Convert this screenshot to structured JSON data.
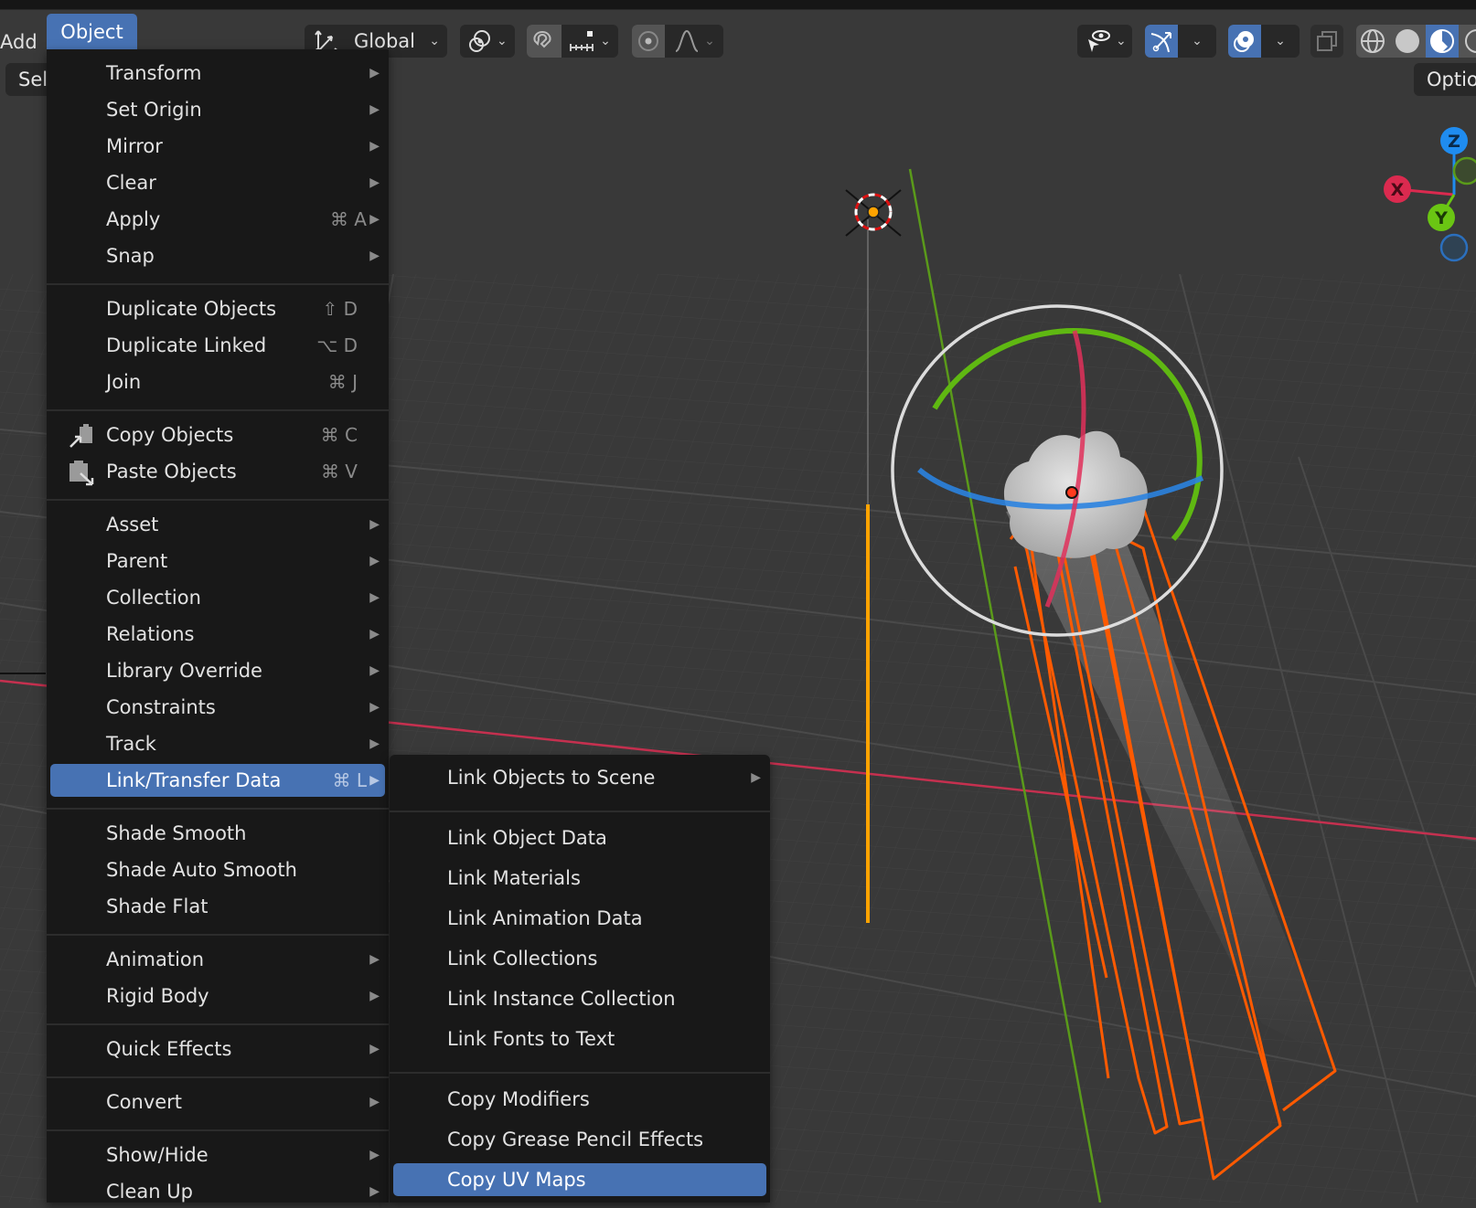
{
  "header": {
    "add_menu": "Add",
    "object_menu": "Object",
    "select_button": "Sel",
    "orientation": {
      "value": "Global",
      "icon": "transform-orientation-icon"
    },
    "pivot": {
      "icon": "pivot-point-icon"
    },
    "snap": {
      "icon": "magnet-snap-icon",
      "increment_icon": "snap-increment-icon"
    },
    "proportional": {
      "icon": "proportional-editing-icon",
      "falloff_icon": "falloff-curve-icon"
    },
    "visibility": {
      "icon": "eye-select-icon"
    },
    "gizmo": {
      "icon": "gizmo-icon",
      "active": true
    },
    "overlays": {
      "icon": "overlays-icon",
      "active": true
    },
    "xray": {
      "icon": "xray-icon"
    },
    "shading": {
      "modes": [
        "wireframe",
        "solid",
        "material-preview",
        "rendered"
      ],
      "active": "material-preview"
    },
    "options_button": "Optio"
  },
  "object_menu": {
    "groups": [
      [
        {
          "label": "Transform",
          "submenu": true
        },
        {
          "label": "Set Origin",
          "submenu": true
        },
        {
          "label": "Mirror",
          "submenu": true
        },
        {
          "label": "Clear",
          "submenu": true
        },
        {
          "label": "Apply",
          "shortcut": "⌘ A",
          "submenu": true
        },
        {
          "label": "Snap",
          "submenu": true
        }
      ],
      [
        {
          "label": "Duplicate Objects",
          "shortcut": "⇧ D"
        },
        {
          "label": "Duplicate Linked",
          "shortcut": "⌥ D"
        },
        {
          "label": "Join",
          "shortcut": "⌘ J"
        }
      ],
      [
        {
          "label": "Copy Objects",
          "shortcut": "⌘ C",
          "icon": "copy-objects-icon"
        },
        {
          "label": "Paste Objects",
          "shortcut": "⌘ V",
          "icon": "paste-objects-icon"
        }
      ],
      [
        {
          "label": "Asset",
          "submenu": true
        },
        {
          "label": "Parent",
          "submenu": true
        },
        {
          "label": "Collection",
          "submenu": true
        },
        {
          "label": "Relations",
          "submenu": true
        },
        {
          "label": "Library Override",
          "submenu": true
        },
        {
          "label": "Constraints",
          "submenu": true
        },
        {
          "label": "Track",
          "submenu": true
        },
        {
          "label": "Link/Transfer Data",
          "shortcut": "⌘ L",
          "submenu": true,
          "highlighted": true
        }
      ],
      [
        {
          "label": "Shade Smooth"
        },
        {
          "label": "Shade Auto Smooth"
        },
        {
          "label": "Shade Flat"
        }
      ],
      [
        {
          "label": "Animation",
          "submenu": true
        },
        {
          "label": "Rigid Body",
          "submenu": true
        }
      ],
      [
        {
          "label": "Quick Effects",
          "submenu": true
        }
      ],
      [
        {
          "label": "Convert",
          "submenu": true
        }
      ],
      [
        {
          "label": "Show/Hide",
          "submenu": true
        },
        {
          "label": "Clean Up",
          "submenu": true
        }
      ]
    ]
  },
  "link_submenu": {
    "groups": [
      [
        {
          "label": "Link Objects to Scene",
          "submenu": true
        }
      ],
      [
        {
          "label": "Link Object Data"
        },
        {
          "label": "Link Materials"
        },
        {
          "label": "Link Animation Data"
        },
        {
          "label": "Link Collections"
        },
        {
          "label": "Link Instance Collection"
        },
        {
          "label": "Link Fonts to Text"
        }
      ],
      [
        {
          "label": "Copy Modifiers"
        },
        {
          "label": "Copy Grease Pencil Effects"
        },
        {
          "label": "Copy UV Maps",
          "highlighted": true
        }
      ]
    ]
  },
  "navigation_gizmo": {
    "x_label": "X",
    "y_label": "Y",
    "z_label": "Z"
  },
  "colors": {
    "accent": "#4772b3",
    "menu_bg": "#181818",
    "viewport_bg": "#393939",
    "x_axis": "#db2a4f",
    "y_axis": "#6ac513",
    "z_axis": "#1f8cf0",
    "selection": "#ff5a00",
    "active_light": "#ffa300"
  }
}
